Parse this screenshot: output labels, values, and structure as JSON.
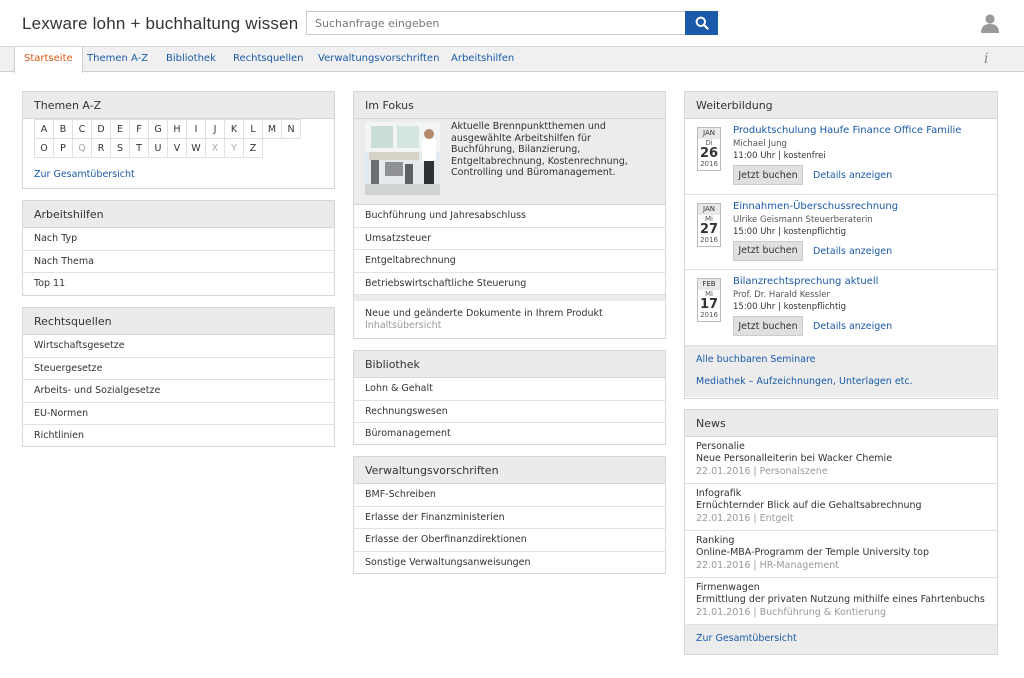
{
  "header": {
    "app_title": "Lexware lohn + buchhaltung wissen",
    "search_placeholder": "Suchanfrage eingeben"
  },
  "nav": {
    "tabs": [
      {
        "label": "Startseite",
        "active": true
      },
      {
        "label": "Themen A-Z"
      },
      {
        "label": "Bibliothek"
      },
      {
        "label": "Rechtsquellen"
      },
      {
        "label": "Verwaltungsvorschriften"
      },
      {
        "label": "Arbeitshilfen"
      }
    ],
    "info_label": "i"
  },
  "themen_az": {
    "title": "Themen A-Z",
    "row1": [
      "A",
      "B",
      "C",
      "D",
      "E",
      "F",
      "G",
      "H",
      "I",
      "J",
      "K",
      "L",
      "M",
      "N"
    ],
    "row2": [
      "O",
      "P",
      "Q",
      "R",
      "S",
      "T",
      "U",
      "V",
      "W",
      "X",
      "Y",
      "Z"
    ],
    "overview_link": "Zur Gesamtübersicht"
  },
  "arbeitshilfen": {
    "title": "Arbeitshilfen",
    "items": [
      "Nach Typ",
      "Nach Thema",
      "Top 11"
    ]
  },
  "rechtsquellen": {
    "title": "Rechtsquellen",
    "items": [
      "Wirtschaftsgesetze",
      "Steuergesetze",
      "Arbeits- und Sozialgesetze",
      "EU-Normen",
      "Richtlinien"
    ]
  },
  "im_fokus": {
    "title": "Im Fokus",
    "text": "Aktuelle Brennpunktthemen und ausgewählte Arbeitshilfen für Buchführung, Bilanzierung, Entgeltabrechnung, Kostenrechnung, Controlling und Büromanagement.",
    "items": [
      "Buchführung und Jahresabschluss",
      "Umsatzsteuer",
      "Entgeltabrechnung",
      "Betriebswirtschaftliche Steuerung"
    ],
    "new_docs_title": "Neue und geänderte Dokumente in Ihrem Produkt",
    "new_docs_sub": "Inhaltsübersicht"
  },
  "bibliothek": {
    "title": "Bibliothek",
    "items": [
      "Lohn & Gehalt",
      "Rechnungswesen",
      "Büromanagement"
    ]
  },
  "verwaltungsvorschriften": {
    "title": "Verwaltungsvorschriften",
    "items": [
      "BMF-Schreiben",
      "Erlasse der Finanzministerien",
      "Erlasse der Oberfinanzdirektionen",
      "Sonstige Verwaltungsanweisungen"
    ]
  },
  "weiterbildung": {
    "title": "Weiterbildung",
    "book_label": "Jetzt buchen",
    "details_label": "Details anzeigen",
    "seminars": [
      {
        "month": "JAN",
        "weekday": "Di",
        "day": "26",
        "year": "2016",
        "title": "Produktschulung Haufe Finance Office Familie",
        "speaker": "Michael Jung",
        "meta": "11:00 Uhr | kostenfrei"
      },
      {
        "month": "JAN",
        "weekday": "Mi",
        "day": "27",
        "year": "2016",
        "title": "Einnahmen-Überschussrechnung",
        "speaker": "Ulrike Geismann Steuerberaterin",
        "meta": "15:00 Uhr | kostenpflichtig"
      },
      {
        "month": "FEB",
        "weekday": "Mi",
        "day": "17",
        "year": "2016",
        "title": "Bilanzrechtsprechung aktuell",
        "speaker": "Prof. Dr. Harald Kessler",
        "meta": "15:00 Uhr | kostenpflichtig"
      }
    ],
    "all_seminars": "Alle buchbaren Seminare",
    "mediathek": "Mediathek – Aufzeichnungen, Unterlagen etc."
  },
  "news": {
    "title": "News",
    "items": [
      {
        "category": "Personalie",
        "title": "Neue Personalleiterin bei Wacker Chemie",
        "meta": "22.01.2016 | Personalszene"
      },
      {
        "category": "Infografik",
        "title": "Ernüchternder Blick auf die Gehaltsabrechnung",
        "meta": "22.01.2016 | Entgelt"
      },
      {
        "category": "Ranking",
        "title": "Online-MBA-Programm der Temple University top",
        "meta": "22.01.2016 | HR-Management"
      },
      {
        "category": "Firmenwagen",
        "title": "Ermittlung der privaten Nutzung mithilfe eines Fahrtenbuchs",
        "meta": "21.01.2016 | Buchführung & Kontierung"
      }
    ],
    "overview_link": "Zur Gesamtübersicht"
  },
  "colors": {
    "accent_blue": "#1a5aa8",
    "active_tab_orange": "#e05a16",
    "panel_header_gray": "#ebebeb"
  }
}
